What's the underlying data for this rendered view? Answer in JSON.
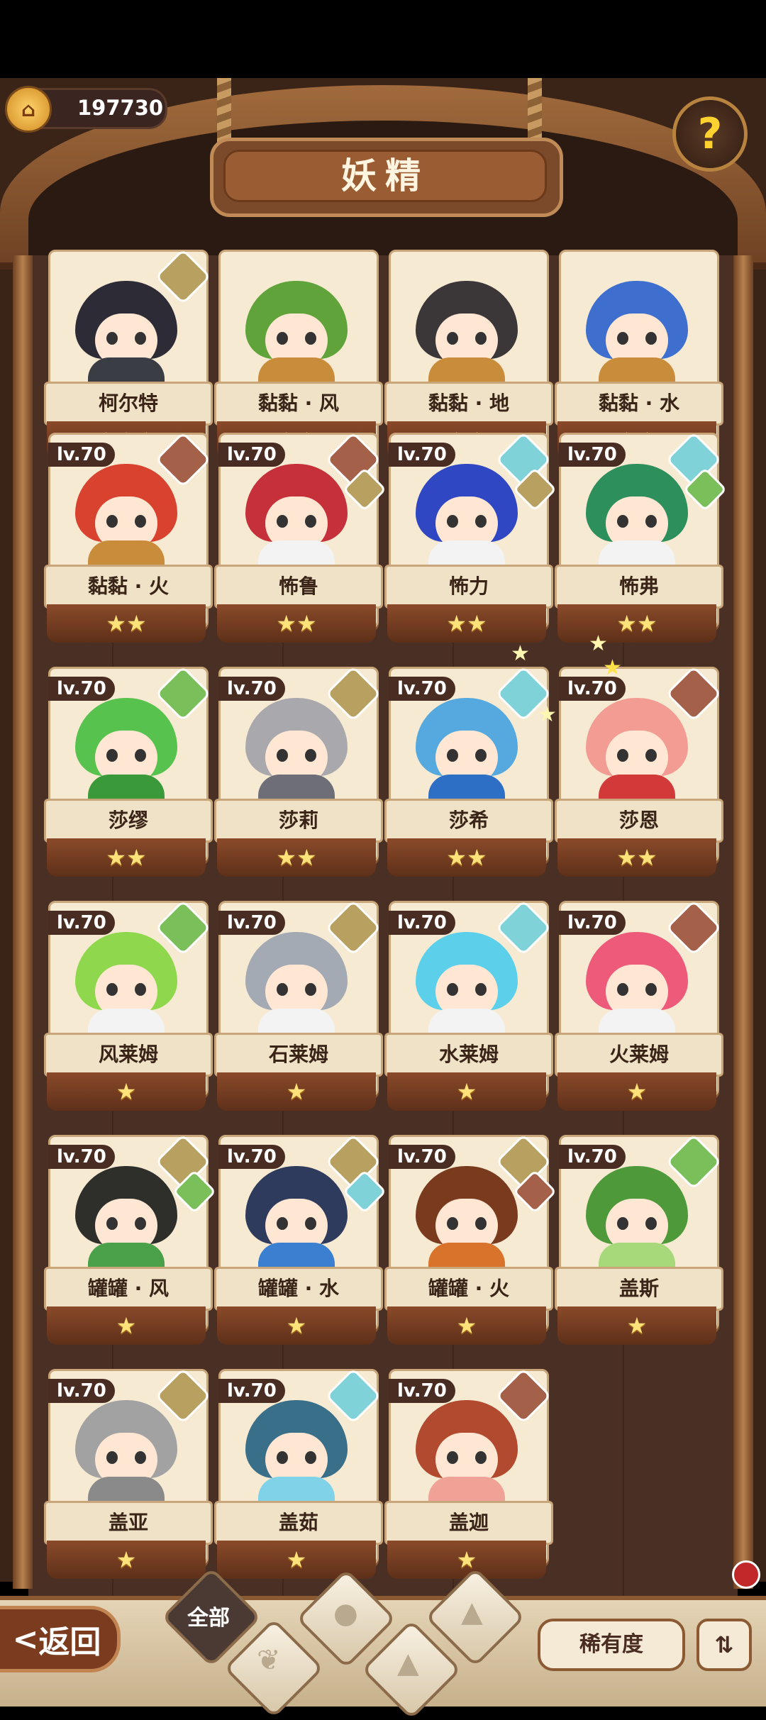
{
  "header": {
    "coins": "197730",
    "title": "妖精"
  },
  "heroes": [
    {
      "name": "柯尔特",
      "level": "",
      "stars": "★★★",
      "hair": "#2d2b35",
      "body": "#3b3d44",
      "elem": [
        "#b7a060"
      ]
    },
    {
      "name": "黏黏 · 风",
      "level": "",
      "stars": "★★",
      "hair": "#5fa33a",
      "body": "#c98c3a",
      "elem": []
    },
    {
      "name": "黏黏 · 地",
      "level": "",
      "stars": "★★",
      "hair": "#3b3638",
      "body": "#c98c3a",
      "elem": []
    },
    {
      "name": "黏黏 · 水",
      "level": "",
      "stars": "★★",
      "hair": "#3f6fce",
      "body": "#c98c3a",
      "elem": []
    },
    {
      "name": "黏黏 · 火",
      "level": "lv.70",
      "stars": "★★",
      "hair": "#d8422e",
      "body": "#c98c3a",
      "elem": [
        "#a5604a"
      ]
    },
    {
      "name": "怖鲁",
      "level": "lv.70",
      "stars": "★★",
      "hair": "#c6303b",
      "body": "#f3f3f3",
      "elem": [
        "#a5604a",
        "#b7a060"
      ]
    },
    {
      "name": "怖力",
      "level": "lv.70",
      "stars": "★★",
      "hair": "#2f47c2",
      "body": "#f3f3f3",
      "elem": [
        "#7fd2d8",
        "#b7a060"
      ]
    },
    {
      "name": "怖弗",
      "level": "lv.70",
      "stars": "★★",
      "hair": "#2d8f5c",
      "body": "#f3f3f3",
      "elem": [
        "#7fd2d8",
        "#7bbf5a"
      ]
    },
    {
      "name": "莎缪",
      "level": "lv.70",
      "stars": "★★",
      "hair": "#58c24e",
      "body": "#3a9a3a",
      "elem": [
        "#7bbf5a"
      ]
    },
    {
      "name": "莎莉",
      "level": "lv.70",
      "stars": "★★",
      "hair": "#a9a9ad",
      "body": "#6e6e78",
      "elem": [
        "#b7a060"
      ]
    },
    {
      "name": "莎希",
      "level": "lv.70",
      "stars": "★★",
      "hair": "#56a9df",
      "body": "#2d6fc4",
      "elem": [
        "#7fd2d8"
      ]
    },
    {
      "name": "莎恩",
      "level": "lv.70",
      "stars": "★★",
      "hair": "#f29c93",
      "body": "#d23a3a",
      "elem": [
        "#a5604a"
      ]
    },
    {
      "name": "风莱姆",
      "level": "lv.70",
      "stars": "★",
      "hair": "#8fd84e",
      "body": "#f3f3f3",
      "elem": [
        "#7bbf5a"
      ]
    },
    {
      "name": "石莱姆",
      "level": "lv.70",
      "stars": "★",
      "hair": "#a3aab3",
      "body": "#f3f3f3",
      "elem": [
        "#b7a060"
      ]
    },
    {
      "name": "水莱姆",
      "level": "lv.70",
      "stars": "★",
      "hair": "#5cd0ea",
      "body": "#f3f3f3",
      "elem": [
        "#7fd2d8"
      ]
    },
    {
      "name": "火莱姆",
      "level": "lv.70",
      "stars": "★",
      "hair": "#ee5b7a",
      "body": "#f3f3f3",
      "elem": [
        "#a5604a"
      ]
    },
    {
      "name": "罐罐 · 风",
      "level": "lv.70",
      "stars": "★",
      "hair": "#2e2e2a",
      "body": "#4aa14a",
      "elem": [
        "#b7a060",
        "#7bbf5a"
      ]
    },
    {
      "name": "罐罐 · 水",
      "level": "lv.70",
      "stars": "★",
      "hair": "#2e3b5c",
      "body": "#3a7fd0",
      "elem": [
        "#b7a060",
        "#7fd2d8"
      ]
    },
    {
      "name": "罐罐 · 火",
      "level": "lv.70",
      "stars": "★",
      "hair": "#7a3a1e",
      "body": "#d9722a",
      "elem": [
        "#b7a060",
        "#a5604a"
      ]
    },
    {
      "name": "盖斯",
      "level": "lv.70",
      "stars": "★",
      "hair": "#4e9a3a",
      "body": "#a7d87a",
      "elem": [
        "#7bbf5a"
      ]
    },
    {
      "name": "盖亚",
      "level": "lv.70",
      "stars": "★",
      "hair": "#a2a2a2",
      "body": "#8a8a8a",
      "elem": [
        "#b7a060"
      ]
    },
    {
      "name": "盖茹",
      "level": "lv.70",
      "stars": "★",
      "hair": "#3a6f8a",
      "body": "#7fd2e8",
      "elem": [
        "#7fd2d8"
      ]
    },
    {
      "name": "盖迦",
      "level": "lv.70",
      "stars": "★",
      "hair": "#b14a2e",
      "body": "#f0a296",
      "elem": [
        "#a5604a"
      ]
    }
  ],
  "footer": {
    "back": "返回",
    "filter_all": "全部",
    "rarity": "稀有度",
    "sort_icon": "sort-icon"
  }
}
